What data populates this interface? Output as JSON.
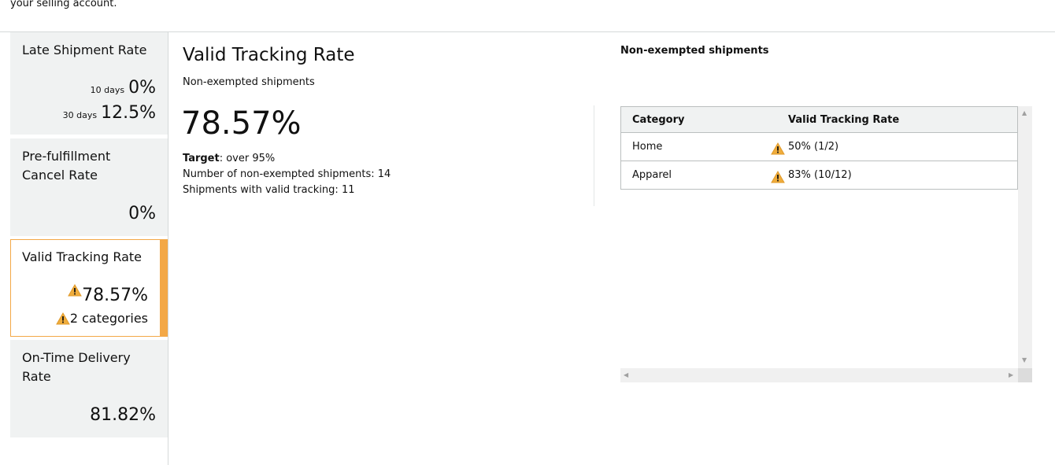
{
  "header": {
    "intro_text": "your selling account."
  },
  "sidebar": {
    "cards": [
      {
        "title": "Late Shipment Rate",
        "rows": [
          {
            "label": "10 days",
            "value": "0%"
          },
          {
            "label": "30 days",
            "value": "12.5%"
          }
        ]
      },
      {
        "title": "Pre-fulfillment Cancel Rate",
        "value": "0%"
      },
      {
        "title": "Valid Tracking Rate",
        "value": "78.57%",
        "categories": "2 categories",
        "selected": true
      },
      {
        "title": "On-Time Delivery Rate",
        "value": "81.82%"
      }
    ]
  },
  "main": {
    "title": "Valid Tracking Rate",
    "subtitle": "Non-exempted shipments",
    "big_value": "78.57%",
    "target_label": "Target",
    "target_value": ": over 95%",
    "non_exempted_line": "Number of non-exempted shipments: 14",
    "valid_tracking_line": "Shipments with valid tracking: 11"
  },
  "right_panel": {
    "title": "Non-exempted shipments",
    "table": {
      "headers": [
        "Category",
        "Valid Tracking Rate"
      ],
      "rows": [
        {
          "category": "Home",
          "rate": "50% (1/2)",
          "warning": true
        },
        {
          "category": "Apparel",
          "rate": "83% (10/12)",
          "warning": true
        }
      ]
    }
  },
  "colors": {
    "accent": "#f3a847",
    "card_bg": "#f0f2f2",
    "warning": "#f0ad3c"
  },
  "icons": {
    "warning": "warning-icon"
  }
}
